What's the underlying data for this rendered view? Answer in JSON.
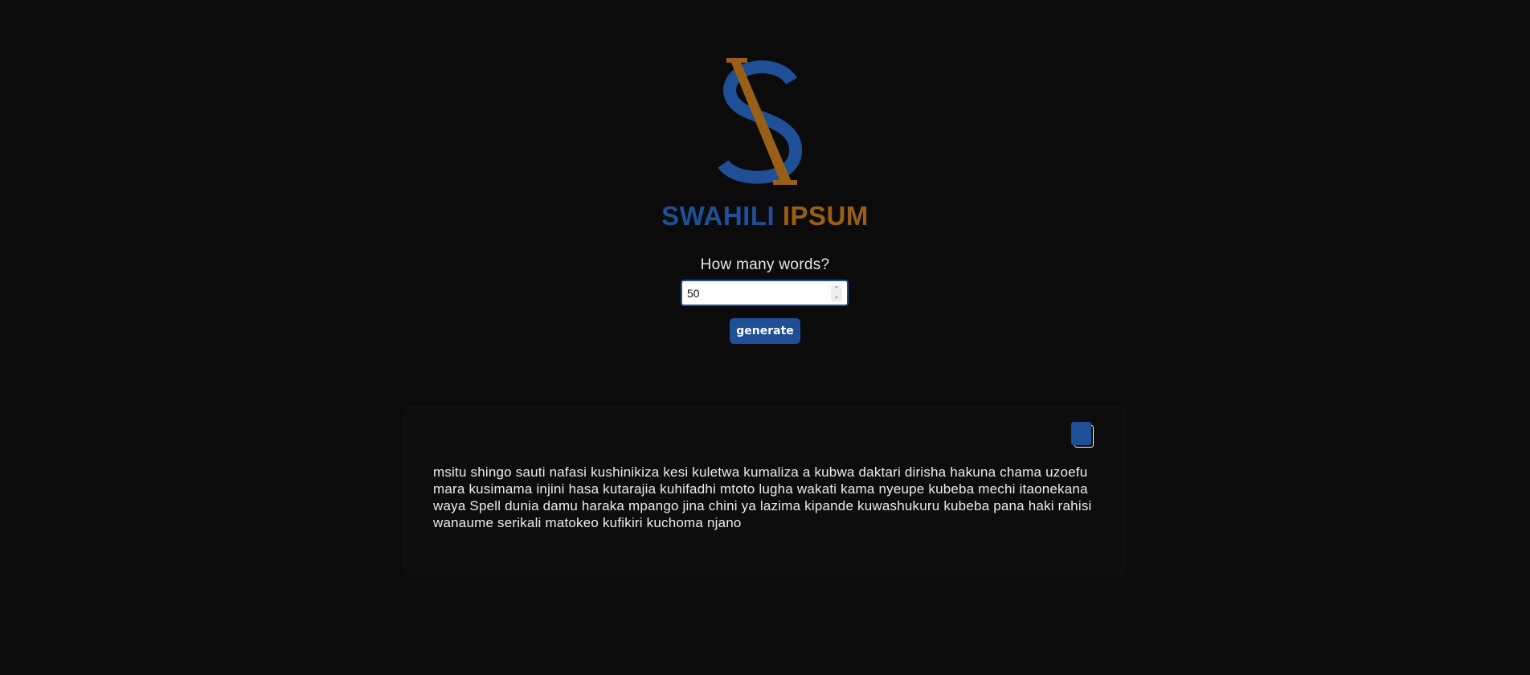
{
  "logo": {
    "icon": "swahili-ipsum-logo-icon",
    "colors": {
      "blue": "#1f4f96",
      "gold": "#9a5f16"
    }
  },
  "brand": {
    "word1": "SWAHILI",
    "word2": "IPSUM"
  },
  "form": {
    "question": "How many words?",
    "word_count": "50",
    "generate_label": "generate"
  },
  "output": {
    "copy_icon": "copy-icon",
    "text": "msitu shingo sauti nafasi kushinikiza kesi kuletwa kumaliza a kubwa daktari dirisha hakuna chama uzoefu mara kusimama injini hasa kutarajia kuhifadhi mtoto lugha wakati kama nyeupe kubeba mechi itaonekana waya Spell dunia damu haraka mpango jina chini ya lazima kipande kuwashukuru kubeba pana haki rahisi wanaume serikali matokeo kufikiri kuchoma njano"
  },
  "theme": {
    "background": "#0b0b0b",
    "accent_blue": "#1f4f96",
    "accent_gold": "#9a5f16"
  }
}
